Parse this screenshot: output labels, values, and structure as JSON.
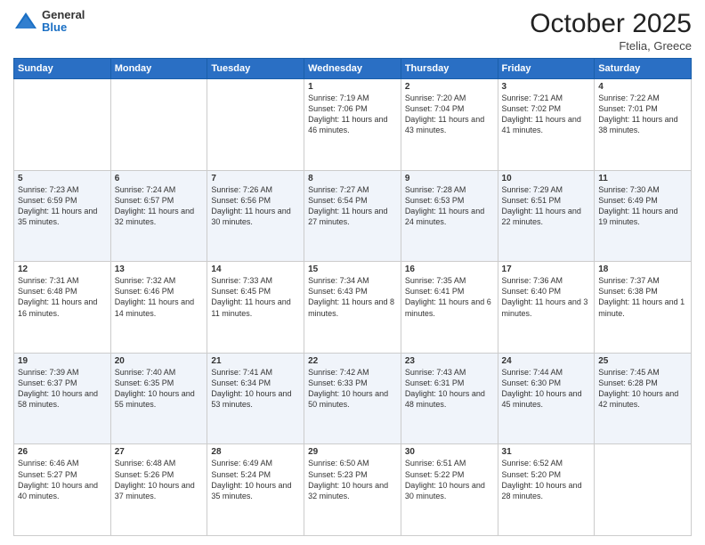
{
  "logo": {
    "general": "General",
    "blue": "Blue"
  },
  "header": {
    "title": "October 2025",
    "subtitle": "Ftelia, Greece"
  },
  "weekdays": [
    "Sunday",
    "Monday",
    "Tuesday",
    "Wednesday",
    "Thursday",
    "Friday",
    "Saturday"
  ],
  "weeks": [
    [
      {
        "day": "",
        "info": ""
      },
      {
        "day": "",
        "info": ""
      },
      {
        "day": "",
        "info": ""
      },
      {
        "day": "1",
        "info": "Sunrise: 7:19 AM\nSunset: 7:06 PM\nDaylight: 11 hours and 46 minutes."
      },
      {
        "day": "2",
        "info": "Sunrise: 7:20 AM\nSunset: 7:04 PM\nDaylight: 11 hours and 43 minutes."
      },
      {
        "day": "3",
        "info": "Sunrise: 7:21 AM\nSunset: 7:02 PM\nDaylight: 11 hours and 41 minutes."
      },
      {
        "day": "4",
        "info": "Sunrise: 7:22 AM\nSunset: 7:01 PM\nDaylight: 11 hours and 38 minutes."
      }
    ],
    [
      {
        "day": "5",
        "info": "Sunrise: 7:23 AM\nSunset: 6:59 PM\nDaylight: 11 hours and 35 minutes."
      },
      {
        "day": "6",
        "info": "Sunrise: 7:24 AM\nSunset: 6:57 PM\nDaylight: 11 hours and 32 minutes."
      },
      {
        "day": "7",
        "info": "Sunrise: 7:26 AM\nSunset: 6:56 PM\nDaylight: 11 hours and 30 minutes."
      },
      {
        "day": "8",
        "info": "Sunrise: 7:27 AM\nSunset: 6:54 PM\nDaylight: 11 hours and 27 minutes."
      },
      {
        "day": "9",
        "info": "Sunrise: 7:28 AM\nSunset: 6:53 PM\nDaylight: 11 hours and 24 minutes."
      },
      {
        "day": "10",
        "info": "Sunrise: 7:29 AM\nSunset: 6:51 PM\nDaylight: 11 hours and 22 minutes."
      },
      {
        "day": "11",
        "info": "Sunrise: 7:30 AM\nSunset: 6:49 PM\nDaylight: 11 hours and 19 minutes."
      }
    ],
    [
      {
        "day": "12",
        "info": "Sunrise: 7:31 AM\nSunset: 6:48 PM\nDaylight: 11 hours and 16 minutes."
      },
      {
        "day": "13",
        "info": "Sunrise: 7:32 AM\nSunset: 6:46 PM\nDaylight: 11 hours and 14 minutes."
      },
      {
        "day": "14",
        "info": "Sunrise: 7:33 AM\nSunset: 6:45 PM\nDaylight: 11 hours and 11 minutes."
      },
      {
        "day": "15",
        "info": "Sunrise: 7:34 AM\nSunset: 6:43 PM\nDaylight: 11 hours and 8 minutes."
      },
      {
        "day": "16",
        "info": "Sunrise: 7:35 AM\nSunset: 6:41 PM\nDaylight: 11 hours and 6 minutes."
      },
      {
        "day": "17",
        "info": "Sunrise: 7:36 AM\nSunset: 6:40 PM\nDaylight: 11 hours and 3 minutes."
      },
      {
        "day": "18",
        "info": "Sunrise: 7:37 AM\nSunset: 6:38 PM\nDaylight: 11 hours and 1 minute."
      }
    ],
    [
      {
        "day": "19",
        "info": "Sunrise: 7:39 AM\nSunset: 6:37 PM\nDaylight: 10 hours and 58 minutes."
      },
      {
        "day": "20",
        "info": "Sunrise: 7:40 AM\nSunset: 6:35 PM\nDaylight: 10 hours and 55 minutes."
      },
      {
        "day": "21",
        "info": "Sunrise: 7:41 AM\nSunset: 6:34 PM\nDaylight: 10 hours and 53 minutes."
      },
      {
        "day": "22",
        "info": "Sunrise: 7:42 AM\nSunset: 6:33 PM\nDaylight: 10 hours and 50 minutes."
      },
      {
        "day": "23",
        "info": "Sunrise: 7:43 AM\nSunset: 6:31 PM\nDaylight: 10 hours and 48 minutes."
      },
      {
        "day": "24",
        "info": "Sunrise: 7:44 AM\nSunset: 6:30 PM\nDaylight: 10 hours and 45 minutes."
      },
      {
        "day": "25",
        "info": "Sunrise: 7:45 AM\nSunset: 6:28 PM\nDaylight: 10 hours and 42 minutes."
      }
    ],
    [
      {
        "day": "26",
        "info": "Sunrise: 6:46 AM\nSunset: 5:27 PM\nDaylight: 10 hours and 40 minutes."
      },
      {
        "day": "27",
        "info": "Sunrise: 6:48 AM\nSunset: 5:26 PM\nDaylight: 10 hours and 37 minutes."
      },
      {
        "day": "28",
        "info": "Sunrise: 6:49 AM\nSunset: 5:24 PM\nDaylight: 10 hours and 35 minutes."
      },
      {
        "day": "29",
        "info": "Sunrise: 6:50 AM\nSunset: 5:23 PM\nDaylight: 10 hours and 32 minutes."
      },
      {
        "day": "30",
        "info": "Sunrise: 6:51 AM\nSunset: 5:22 PM\nDaylight: 10 hours and 30 minutes."
      },
      {
        "day": "31",
        "info": "Sunrise: 6:52 AM\nSunset: 5:20 PM\nDaylight: 10 hours and 28 minutes."
      },
      {
        "day": "",
        "info": ""
      }
    ]
  ]
}
